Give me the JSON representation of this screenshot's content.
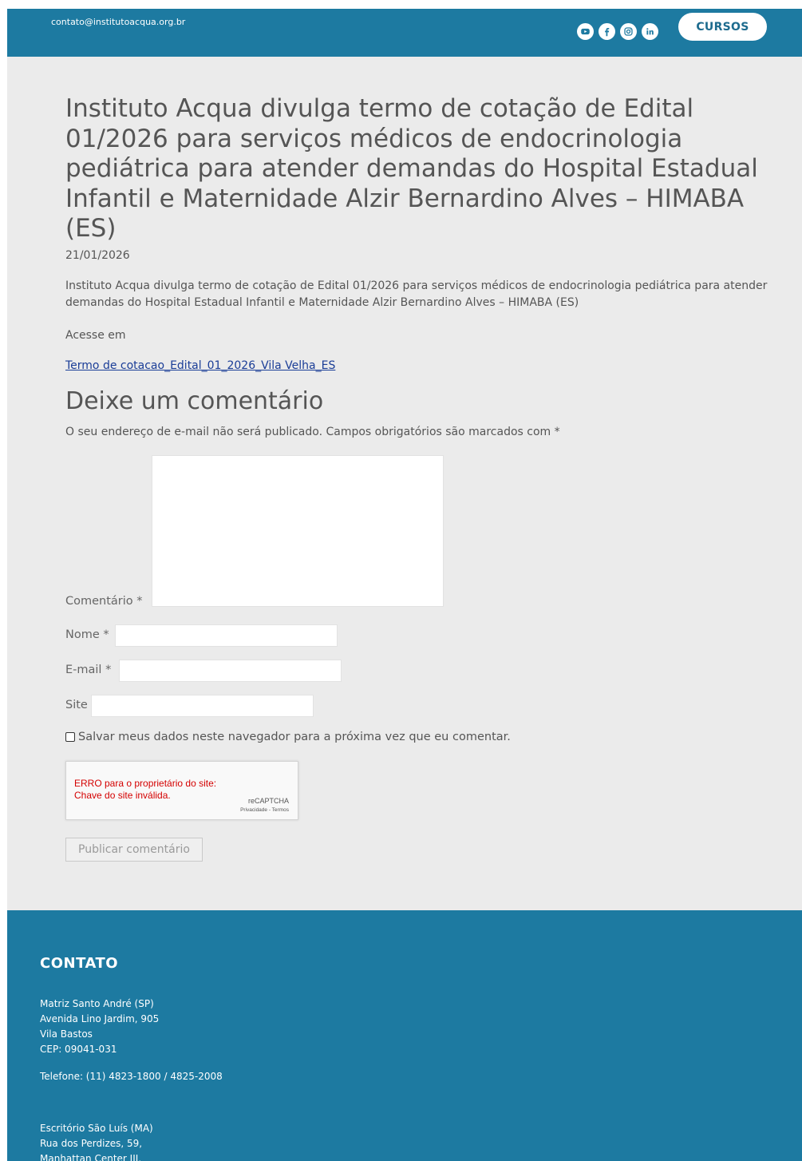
{
  "topbar": {
    "email": "contato@institutoacqua.org.br",
    "social_icons": [
      "youtube-icon",
      "facebook-icon",
      "instagram-icon",
      "linkedin-icon"
    ],
    "cursos_label": "CURSOS"
  },
  "post": {
    "title": "Instituto Acqua divulga termo de cotação de Edital 01/2026 para serviços médicos de endocrinologia pediátrica para atender demandas do Hospital Estadual Infantil e Maternidade Alzir Bernardino Alves – HIMABA (ES)",
    "date": "21/01/2026",
    "excerpt": "Instituto Acqua divulga termo de cotação de Edital 01/2026 para serviços médicos de endocrinologia pediátrica para atender demandas do Hospital Estadual Infantil e Maternidade Alzir Bernardino Alves – HIMABA (ES)",
    "access_label": "Acesse em",
    "file_link": "Termo de cotacao_Edital_01_2026_Vila Velha_ES"
  },
  "comment_form": {
    "title": "Deixe um comentário",
    "notes": "O seu endereço de e-mail não será publicado. Campos obrigatórios são marcados com *",
    "comment_label": "Comentário *",
    "name_label": "Nome *",
    "email_label": "E-mail *",
    "site_label": "Site",
    "cookies_label": "Salvar meus dados neste navegador para a próxima vez que eu comentar.",
    "recaptcha_error": "ERRO para o proprietário do site: Chave do site inválida.",
    "recaptcha_brand": "reCAPTCHA",
    "recaptcha_terms": "Privacidade - Termos",
    "submit_label": "Publicar comentário"
  },
  "footer": {
    "heading": "CONTATO",
    "office1": [
      "Matriz Santo André (SP)",
      "Avenida Lino Jardim, 905",
      "Vila Bastos",
      "CEP: 09041-031"
    ],
    "phone": "Telefone: (11) 4823-1800 / 4825-2008",
    "office2": [
      "Escritório São Luís (MA)",
      "Rua dos Perdizes, 59,",
      "Manhattan Center III,"
    ]
  },
  "colors": {
    "brand_blue": "#1d7aa1",
    "page_bg": "#ebebeb",
    "link": "#1a3d97",
    "error_red": "#d40000"
  }
}
